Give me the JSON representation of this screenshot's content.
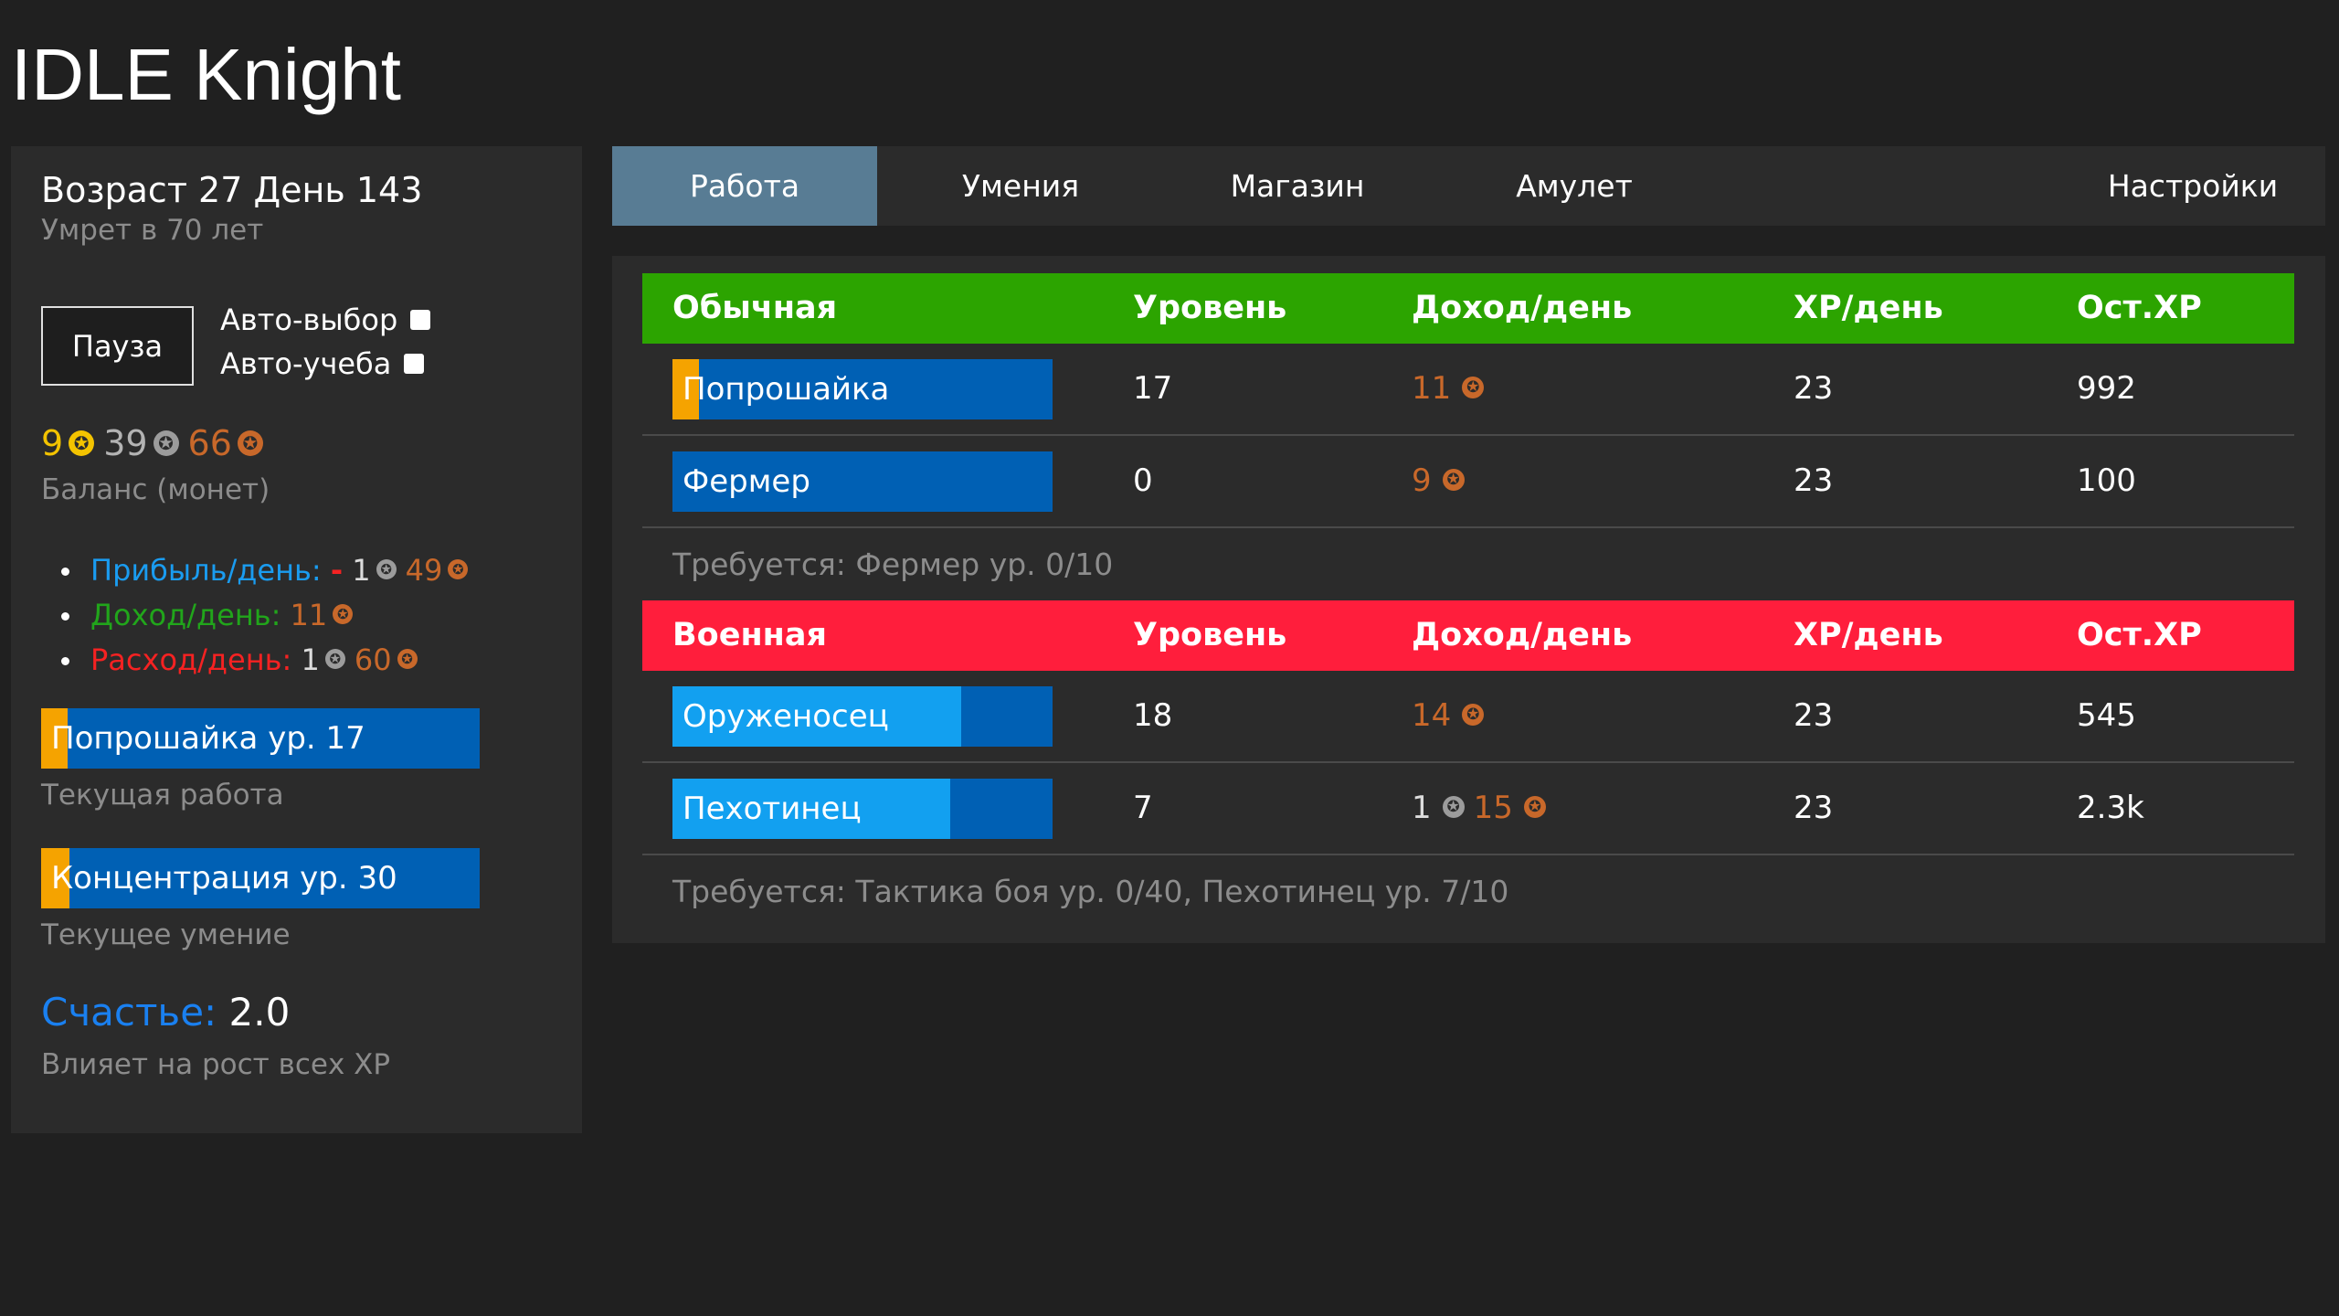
{
  "app": {
    "title": "IDLE Knight"
  },
  "sidebar": {
    "age_line": "Возраст 27 День 143",
    "death_note": "Умрет в 70 лет",
    "pause_label": "Пауза",
    "auto_pick_label": "Авто-выбор",
    "auto_learn_label": "Авто-учеба",
    "balance": {
      "gold": "9",
      "silver": "39",
      "copper": "66"
    },
    "balance_label": "Баланс (монет)",
    "profit": {
      "label": "Прибыль/день:",
      "sign": "-",
      "silver": "1",
      "copper": "49"
    },
    "income": {
      "label": "Доход/день:",
      "copper": "11"
    },
    "expense": {
      "label": "Расход/день:",
      "silver": "1",
      "copper": "60"
    },
    "current_job": {
      "label": "Попрошайка ур. 17",
      "progress": 0.06
    },
    "current_job_caption": "Текущая работа",
    "current_skill": {
      "label": "Концентрация ур. 30",
      "progress": 0.065
    },
    "current_skill_caption": "Текущее умение",
    "happiness": {
      "key": "Счастье:",
      "value": "2.0"
    },
    "happiness_caption": "Влияет на рост всех XP"
  },
  "tabs": [
    "Работа",
    "Умения",
    "Магазин",
    "Амулет",
    "Настройки"
  ],
  "tables": [
    {
      "name": "Обычная",
      "columns": [
        "Уровень",
        "Доход/день",
        "XP/день",
        "Ост.XP"
      ],
      "rows": [
        {
          "name": "Попрошайка",
          "level": "17",
          "income_silver": "",
          "income_copper": "11",
          "xp": "23",
          "remaining": "992",
          "progress": 0.07,
          "style": "yellow"
        },
        {
          "name": "Фермер",
          "level": "0",
          "income_silver": "",
          "income_copper": "9",
          "xp": "23",
          "remaining": "100",
          "progress": 0.0,
          "style": "yellow"
        }
      ],
      "requirement": "Требуется: Фермер ур. 0/10"
    },
    {
      "name": "Военная",
      "columns": [
        "Уровень",
        "Доход/день",
        "XP/день",
        "Ост.XP"
      ],
      "rows": [
        {
          "name": "Оруженосец",
          "level": "18",
          "income_silver": "",
          "income_copper": "14",
          "xp": "23",
          "remaining": "545",
          "progress": 0.76,
          "style": "blue"
        },
        {
          "name": "Пехотинец",
          "level": "7",
          "income_silver": "1",
          "income_copper": "15",
          "xp": "23",
          "remaining": "2.3k",
          "progress": 0.73,
          "style": "blue"
        }
      ],
      "requirement": "Требуется: Тактика боя ур. 0/40, Пехотинец ур. 7/10"
    }
  ],
  "colors": {
    "accent_tab": "#587c94",
    "common": "#2ca400",
    "military": "#ff1e3c",
    "bar": "#0060b4"
  }
}
